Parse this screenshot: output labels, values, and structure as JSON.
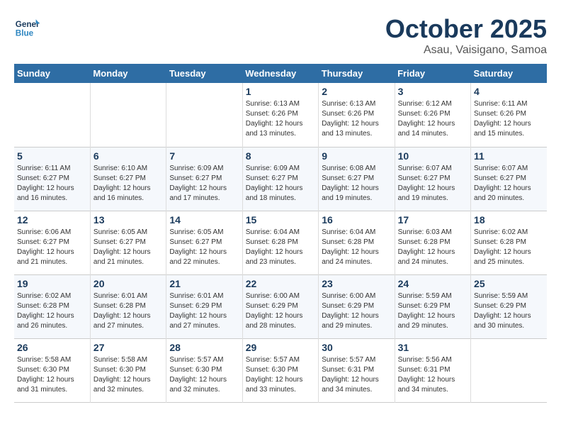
{
  "header": {
    "logo_line1": "General",
    "logo_line2": "Blue",
    "month": "October 2025",
    "location": "Asau, Vaisigano, Samoa"
  },
  "weekdays": [
    "Sunday",
    "Monday",
    "Tuesday",
    "Wednesday",
    "Thursday",
    "Friday",
    "Saturday"
  ],
  "weeks": [
    [
      {
        "day": "",
        "info": ""
      },
      {
        "day": "",
        "info": ""
      },
      {
        "day": "",
        "info": ""
      },
      {
        "day": "1",
        "info": "Sunrise: 6:13 AM\nSunset: 6:26 PM\nDaylight: 12 hours\nand 13 minutes."
      },
      {
        "day": "2",
        "info": "Sunrise: 6:13 AM\nSunset: 6:26 PM\nDaylight: 12 hours\nand 13 minutes."
      },
      {
        "day": "3",
        "info": "Sunrise: 6:12 AM\nSunset: 6:26 PM\nDaylight: 12 hours\nand 14 minutes."
      },
      {
        "day": "4",
        "info": "Sunrise: 6:11 AM\nSunset: 6:26 PM\nDaylight: 12 hours\nand 15 minutes."
      }
    ],
    [
      {
        "day": "5",
        "info": "Sunrise: 6:11 AM\nSunset: 6:27 PM\nDaylight: 12 hours\nand 16 minutes."
      },
      {
        "day": "6",
        "info": "Sunrise: 6:10 AM\nSunset: 6:27 PM\nDaylight: 12 hours\nand 16 minutes."
      },
      {
        "day": "7",
        "info": "Sunrise: 6:09 AM\nSunset: 6:27 PM\nDaylight: 12 hours\nand 17 minutes."
      },
      {
        "day": "8",
        "info": "Sunrise: 6:09 AM\nSunset: 6:27 PM\nDaylight: 12 hours\nand 18 minutes."
      },
      {
        "day": "9",
        "info": "Sunrise: 6:08 AM\nSunset: 6:27 PM\nDaylight: 12 hours\nand 19 minutes."
      },
      {
        "day": "10",
        "info": "Sunrise: 6:07 AM\nSunset: 6:27 PM\nDaylight: 12 hours\nand 19 minutes."
      },
      {
        "day": "11",
        "info": "Sunrise: 6:07 AM\nSunset: 6:27 PM\nDaylight: 12 hours\nand 20 minutes."
      }
    ],
    [
      {
        "day": "12",
        "info": "Sunrise: 6:06 AM\nSunset: 6:27 PM\nDaylight: 12 hours\nand 21 minutes."
      },
      {
        "day": "13",
        "info": "Sunrise: 6:05 AM\nSunset: 6:27 PM\nDaylight: 12 hours\nand 21 minutes."
      },
      {
        "day": "14",
        "info": "Sunrise: 6:05 AM\nSunset: 6:27 PM\nDaylight: 12 hours\nand 22 minutes."
      },
      {
        "day": "15",
        "info": "Sunrise: 6:04 AM\nSunset: 6:28 PM\nDaylight: 12 hours\nand 23 minutes."
      },
      {
        "day": "16",
        "info": "Sunrise: 6:04 AM\nSunset: 6:28 PM\nDaylight: 12 hours\nand 24 minutes."
      },
      {
        "day": "17",
        "info": "Sunrise: 6:03 AM\nSunset: 6:28 PM\nDaylight: 12 hours\nand 24 minutes."
      },
      {
        "day": "18",
        "info": "Sunrise: 6:02 AM\nSunset: 6:28 PM\nDaylight: 12 hours\nand 25 minutes."
      }
    ],
    [
      {
        "day": "19",
        "info": "Sunrise: 6:02 AM\nSunset: 6:28 PM\nDaylight: 12 hours\nand 26 minutes."
      },
      {
        "day": "20",
        "info": "Sunrise: 6:01 AM\nSunset: 6:28 PM\nDaylight: 12 hours\nand 27 minutes."
      },
      {
        "day": "21",
        "info": "Sunrise: 6:01 AM\nSunset: 6:29 PM\nDaylight: 12 hours\nand 27 minutes."
      },
      {
        "day": "22",
        "info": "Sunrise: 6:00 AM\nSunset: 6:29 PM\nDaylight: 12 hours\nand 28 minutes."
      },
      {
        "day": "23",
        "info": "Sunrise: 6:00 AM\nSunset: 6:29 PM\nDaylight: 12 hours\nand 29 minutes."
      },
      {
        "day": "24",
        "info": "Sunrise: 5:59 AM\nSunset: 6:29 PM\nDaylight: 12 hours\nand 29 minutes."
      },
      {
        "day": "25",
        "info": "Sunrise: 5:59 AM\nSunset: 6:29 PM\nDaylight: 12 hours\nand 30 minutes."
      }
    ],
    [
      {
        "day": "26",
        "info": "Sunrise: 5:58 AM\nSunset: 6:30 PM\nDaylight: 12 hours\nand 31 minutes."
      },
      {
        "day": "27",
        "info": "Sunrise: 5:58 AM\nSunset: 6:30 PM\nDaylight: 12 hours\nand 32 minutes."
      },
      {
        "day": "28",
        "info": "Sunrise: 5:57 AM\nSunset: 6:30 PM\nDaylight: 12 hours\nand 32 minutes."
      },
      {
        "day": "29",
        "info": "Sunrise: 5:57 AM\nSunset: 6:30 PM\nDaylight: 12 hours\nand 33 minutes."
      },
      {
        "day": "30",
        "info": "Sunrise: 5:57 AM\nSunset: 6:31 PM\nDaylight: 12 hours\nand 34 minutes."
      },
      {
        "day": "31",
        "info": "Sunrise: 5:56 AM\nSunset: 6:31 PM\nDaylight: 12 hours\nand 34 minutes."
      },
      {
        "day": "",
        "info": ""
      }
    ]
  ]
}
